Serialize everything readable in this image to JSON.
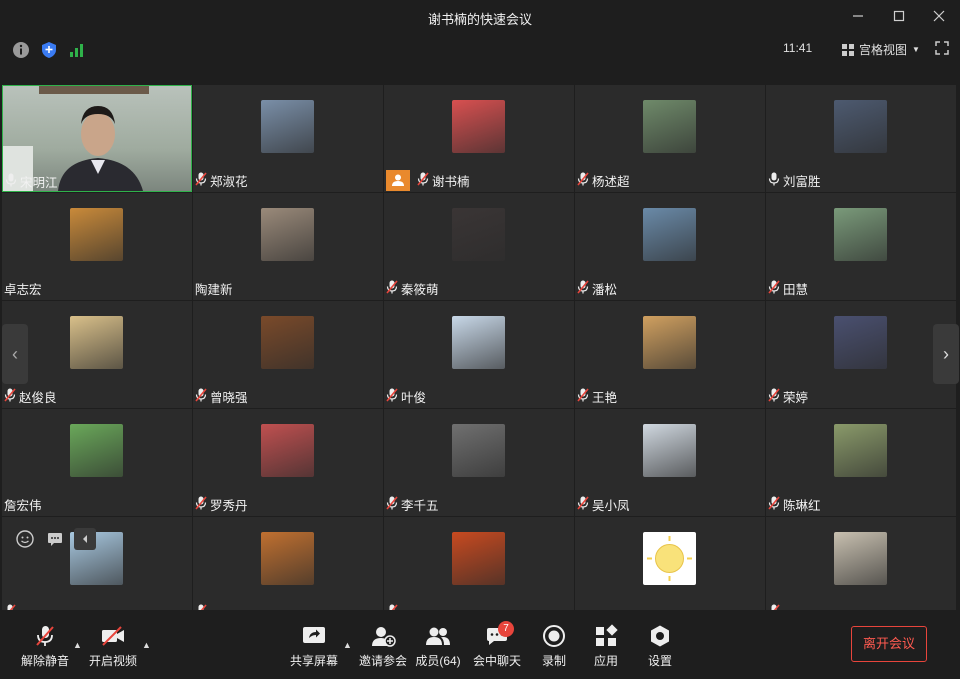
{
  "window": {
    "title": "谢书楠的快速会议"
  },
  "status": {
    "time": "11:41",
    "view_label": "宫格视图"
  },
  "participants": [
    {
      "name": "宋明江",
      "thumb": "video-feed",
      "mic": "on",
      "color": "#8fa39a"
    },
    {
      "name": "郑淑花",
      "thumb": "house-photo",
      "mic": "muted",
      "color": "#7a8fa8"
    },
    {
      "name": "谢书楠",
      "thumb": "portrait-photo",
      "mic": "muted",
      "color": "#d85050",
      "host": true
    },
    {
      "name": "杨述超",
      "thumb": "waterfall-photo",
      "mic": "muted",
      "color": "#6f8a6a"
    },
    {
      "name": "刘富胜",
      "thumb": "office-photo",
      "mic": "on",
      "color": "#4d5a70"
    },
    {
      "name": "卓志宏",
      "thumb": "mountain-sunset-photo",
      "mic": "none",
      "color": "#c98a3a"
    },
    {
      "name": "陶建新",
      "thumb": "sunset-beach-photo",
      "mic": "none",
      "color": "#9a8a7a"
    },
    {
      "name": "秦筱萌",
      "thumb": "portrait-photo",
      "mic": "muted",
      "color": "#3a3535"
    },
    {
      "name": "潘松",
      "thumb": "mountain-photo",
      "mic": "muted",
      "color": "#6a8aa8"
    },
    {
      "name": "田慧",
      "thumb": "landscape-photo",
      "mic": "muted",
      "color": "#7a9a7a"
    },
    {
      "name": "赵俊良",
      "thumb": "paper-texture",
      "mic": "muted",
      "color": "#d9c08a"
    },
    {
      "name": "曾晓强",
      "thumb": "room-photo",
      "mic": "muted",
      "color": "#7a4a2a"
    },
    {
      "name": "叶俊",
      "thumb": "snow-photo",
      "mic": "muted",
      "color": "#c8d8e8"
    },
    {
      "name": "王艳",
      "thumb": "desert-photo",
      "mic": "muted",
      "color": "#d0a060"
    },
    {
      "name": "荣婷",
      "thumb": "lake-dusk-photo",
      "mic": "muted",
      "color": "#4a5070"
    },
    {
      "name": "詹宏伟",
      "thumb": "meadow-photo",
      "mic": "none",
      "color": "#6aa85a"
    },
    {
      "name": "罗秀丹",
      "thumb": "pattern-art",
      "mic": "muted",
      "color": "#c05050"
    },
    {
      "name": "李千五",
      "thumb": "portrait-photo",
      "mic": "muted",
      "color": "#707070"
    },
    {
      "name": "吴小凤",
      "thumb": "ski-photo",
      "mic": "muted",
      "color": "#d0d8e0"
    },
    {
      "name": "陈琳红",
      "thumb": "flower-field-photo",
      "mic": "muted",
      "color": "#8a9a6a"
    },
    {
      "name": "",
      "thumb": "portrait-photo",
      "mic": "muted",
      "color": "#a8c8e0"
    },
    {
      "name": "",
      "thumb": "autumn-road-photo",
      "mic": "muted",
      "color": "#c07030"
    },
    {
      "name": "",
      "thumb": "red-sunset-photo",
      "mic": "muted",
      "color": "#c84a20"
    },
    {
      "name": "",
      "thumb": "sun-emoji",
      "mic": "none",
      "color": "#ffffff"
    },
    {
      "name": "",
      "thumb": "foggy-field-photo",
      "mic": "muted",
      "color": "#c8c0b0"
    }
  ],
  "toolbar": {
    "unmute": "解除静音",
    "start_video": "开启视频",
    "share_screen": "共享屏幕",
    "invite": "邀请参会",
    "members": "成员(64)",
    "chat": "会中聊天",
    "chat_badge": "7",
    "record": "录制",
    "apps": "应用",
    "settings": "设置",
    "leave": "离开会议"
  },
  "colors": {
    "accent_green": "#2fb24a",
    "host_badge": "#e9892d",
    "leave_red": "#e8453c",
    "security_blue": "#3a7bf2"
  }
}
